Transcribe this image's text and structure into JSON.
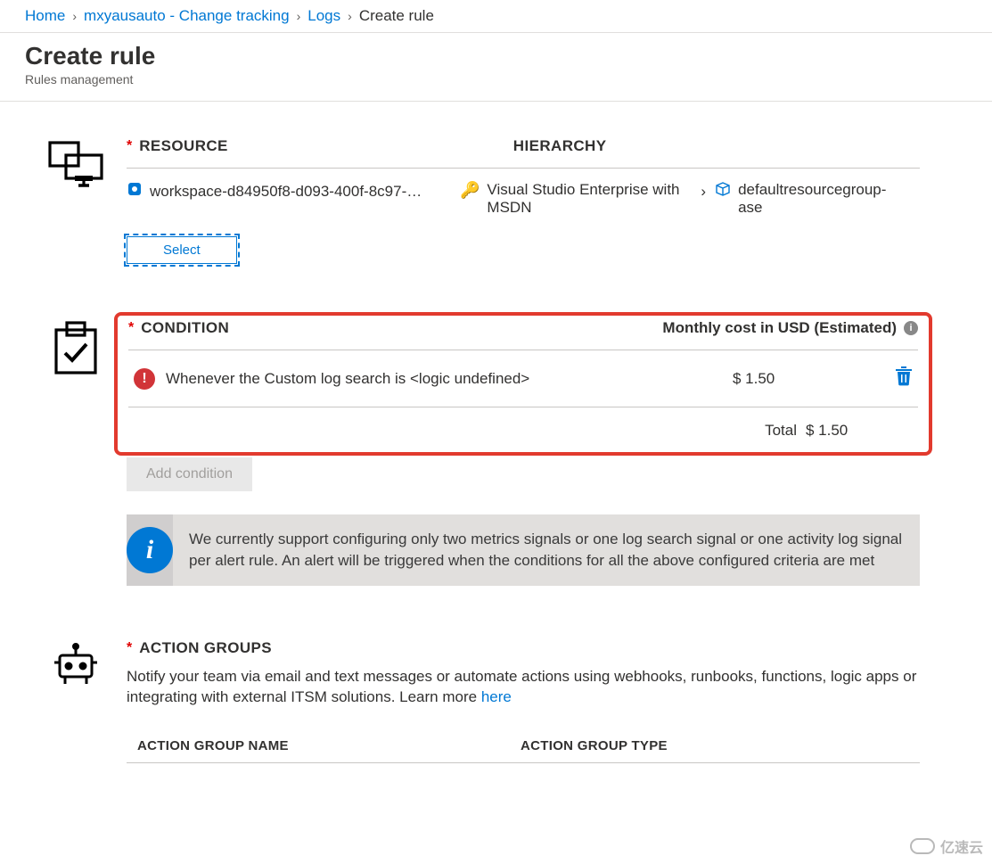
{
  "breadcrumb": {
    "items": [
      "Home",
      "mxyausauto - Change tracking",
      "Logs"
    ],
    "current": "Create rule"
  },
  "header": {
    "title": "Create rule",
    "subtitle": "Rules management"
  },
  "resource": {
    "title": "RESOURCE",
    "hierarchy_title": "HIERARCHY",
    "name": "workspace-d84950f8-d093-400f-8c97-…",
    "subscription": "Visual Studio Enterprise with MSDN",
    "resource_group": "defaultresourcegroup-ase",
    "select_label": "Select"
  },
  "condition": {
    "title": "CONDITION",
    "cost_title": "Monthly cost in USD (Estimated)",
    "row_text": "Whenever the Custom log search is <logic undefined>",
    "row_cost": "$ 1.50",
    "total_label": "Total",
    "total_value": "$ 1.50",
    "add_label": "Add condition",
    "info_message": "We currently support configuring only two metrics signals or one log search signal or one activity log signal per alert rule. An alert will be triggered when the conditions for all the above configured criteria are met"
  },
  "action_groups": {
    "title": "ACTION GROUPS",
    "description_prefix": "Notify your team via email and text messages or automate actions using webhooks, runbooks, functions, logic apps or integrating with external ITSM solutions. Learn more ",
    "learn_more": "here",
    "col_name": "ACTION GROUP NAME",
    "col_type": "ACTION GROUP TYPE"
  },
  "watermark": "亿速云"
}
